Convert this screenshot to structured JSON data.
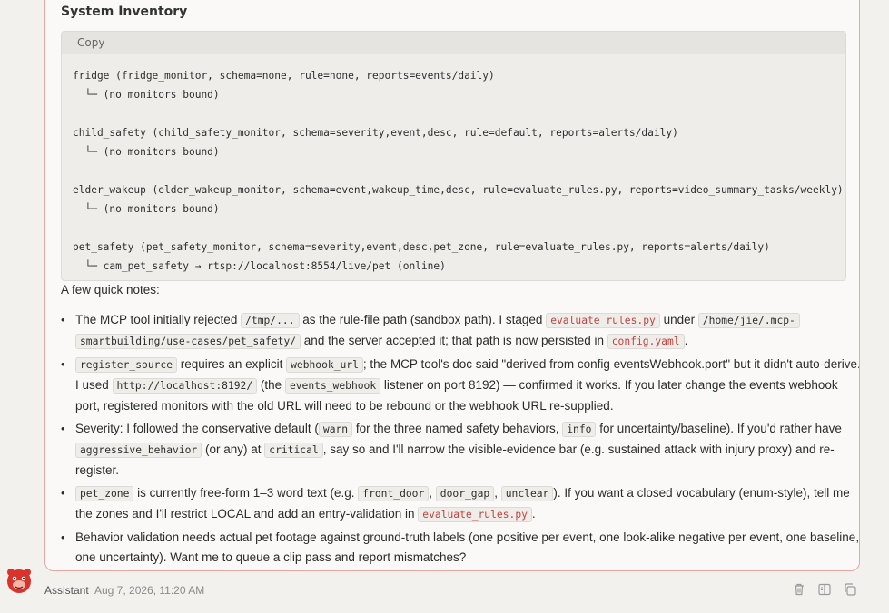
{
  "section_title": "System Inventory",
  "code": {
    "copy_label": "Copy",
    "lines": [
      "fridge (fridge_monitor, schema=none, rule=none, reports=events/daily)",
      "  └─ (no monitors bound)",
      "",
      "child_safety (child_safety_monitor, schema=severity,event,desc, rule=default, reports=alerts/daily)",
      "  └─ (no monitors bound)",
      "",
      "elder_wakeup (elder_wakeup_monitor, schema=event,wakeup_time,desc, rule=evaluate_rules.py, reports=video_summary_tasks/weekly)",
      "  └─ (no monitors bound)",
      "",
      "pet_safety (pet_safety_monitor, schema=severity,event,desc,pet_zone, rule=evaluate_rules.py, reports=alerts/daily)",
      "  └─ cam_pet_safety → rtsp://localhost:8554/live/pet (online)"
    ]
  },
  "notes_intro": "A few quick notes:",
  "notes": {
    "n1": {
      "t1": "The MCP tool initially rejected ",
      "c1": "/tmp/...",
      "t2": " as the rule-file path (sandbox path). I staged ",
      "c2": "evaluate_rules.py",
      "t3": " under ",
      "c3a": "/home/jie/.mcp-",
      "c3b": "smartbuilding/use-cases/pet_safety/",
      "t4": " and the server accepted it; that path is now persisted in ",
      "c4": "config.yaml",
      "t5": "."
    },
    "n2": {
      "c1": "register_source",
      "t1": " requires an explicit ",
      "c2": "webhook_url",
      "t2": "; the MCP tool's doc said \"derived from config eventsWebhook.port\" but it didn't auto-derive. I used ",
      "c3": "http://localhost:8192/",
      "t3": " (the ",
      "c4": "events_webhook",
      "t4": " listener on port 8192) — confirmed it works. If you later change the events webhook port, registered monitors with the old URL will need to be rebound or the webhook URL re-supplied."
    },
    "n3": {
      "t1": "Severity: I followed the conservative default (",
      "c1": "warn",
      "t2": " for the three named safety behaviors, ",
      "c2": "info",
      "t3": " for uncertainty/baseline). If you'd rather have ",
      "c3": "aggressive_behavior",
      "t4": " (or any) at ",
      "c4": "critical",
      "t5": ", say so and I'll narrow the visible-evidence bar (e.g. sustained attack with injury proxy) and re-register."
    },
    "n4": {
      "c1": "pet_zone",
      "t1": " is currently free-form 1–3 word text (e.g. ",
      "c2": "front_door",
      "t2": ", ",
      "c3": "door_gap",
      "t3": ", ",
      "c4": "unclear",
      "t4": "). If you want a closed vocabulary (enum-style), tell me the zones and I'll restrict LOCAL and add an entry-validation in ",
      "c5": "evaluate_rules.py",
      "t5": "."
    },
    "n5": {
      "t1": "Behavior validation needs actual pet footage against ground-truth labels (one positive per event, one look-alike negative per event, one baseline, one uncertainty). Want me to queue a clip pass and report mismatches?"
    }
  },
  "footer": {
    "author": "Assistant",
    "timestamp": "Aug 7, 2026, 11:20 AM",
    "actions": [
      "trash-icon",
      "split-view-icon",
      "copy-icon"
    ]
  },
  "colors": {
    "accent_border": "#e5a8a2",
    "code_red": "#c1443e",
    "avatar_red": "#d9332b"
  }
}
